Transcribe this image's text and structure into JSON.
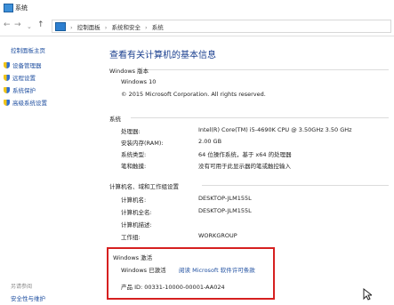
{
  "window": {
    "title": "系统"
  },
  "address": {
    "crumbs": [
      "控制面板",
      "系统和安全",
      "系统"
    ]
  },
  "sidebar": {
    "home": "控制面板主页",
    "items": [
      {
        "label": "设备管理器",
        "icon": "shield-icon"
      },
      {
        "label": "远程设置",
        "icon": "shield-icon"
      },
      {
        "label": "系统保护",
        "icon": "shield-icon"
      },
      {
        "label": "高级系统设置",
        "icon": "shield-icon"
      }
    ],
    "see_also": "另请参阅",
    "bottom_link": "安全性与维护"
  },
  "main": {
    "title": "查看有关计算机的基本信息",
    "edition": {
      "heading": "Windows 版本",
      "name": "Windows 10",
      "copyright": "© 2015 Microsoft Corporation. All rights reserved."
    },
    "system": {
      "heading": "系统",
      "rows": [
        {
          "label": "处理器:",
          "value": "Intel(R) Core(TM) i5-4690K CPU @ 3.50GHz   3.50 GHz"
        },
        {
          "label": "安装内存(RAM):",
          "value": "2.00 GB"
        },
        {
          "label": "系统类型:",
          "value": "64 位操作系统，基于 x64 的处理器"
        },
        {
          "label": "笔和触摸:",
          "value": "没有可用于此显示器的笔或触控输入"
        }
      ]
    },
    "computer": {
      "heading": "计算机名、域和工作组设置",
      "rows": [
        {
          "label": "计算机名:",
          "value": "DESKTOP-JLM155L"
        },
        {
          "label": "计算机全名:",
          "value": "DESKTOP-JLM155L"
        },
        {
          "label": "计算机描述:",
          "value": ""
        },
        {
          "label": "工作组:",
          "value": "WORKGROUP"
        }
      ]
    },
    "activation": {
      "heading": "Windows 激活",
      "status": "Windows 已激活",
      "license_link": "阅读 Microsoft 软件许可条款",
      "product_id": "产品 ID: 00331-10000-00001-AA024"
    }
  },
  "colors": {
    "link": "#1f4fa0",
    "title": "#1a3f8f",
    "highlight_border": "#d62020"
  }
}
